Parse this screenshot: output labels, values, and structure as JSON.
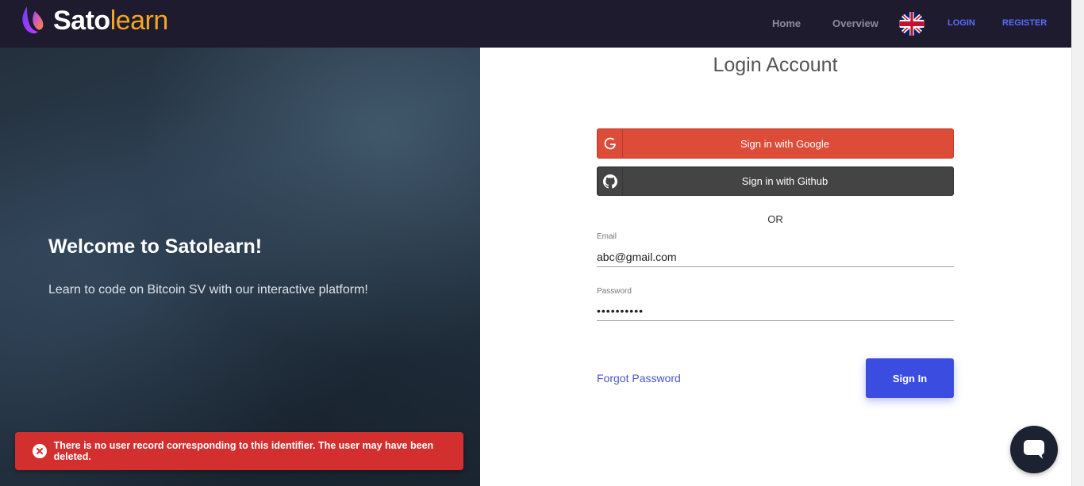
{
  "header": {
    "logo_part1": "Sato",
    "logo_part2": "learn",
    "nav_home": "Home",
    "nav_overview": "Overview",
    "nav_login": "LOGIN",
    "nav_register": "REGISTER",
    "flag_icon": "uk-flag-icon"
  },
  "hero": {
    "title": "Welcome to Satolearn!",
    "subtitle": "Learn to code on Bitcoin SV with our interactive platform!"
  },
  "login": {
    "title": "Login Account",
    "google_label": "Sign in with Google",
    "github_label": "Sign in with Github",
    "or_text": "OR",
    "email_label": "Email",
    "email_value": "abc@gmail.com",
    "password_label": "Password",
    "password_value": "••••••••••",
    "forgot_label": "Forgot Password",
    "signin_label": "Sign In"
  },
  "toast": {
    "message": "There is no user record corresponding to this identifier. The user may have been deleted."
  },
  "colors": {
    "header_bg": "#1d1b2d",
    "brand_orange": "#f5a623",
    "google_red": "#dd4b39",
    "github_gray": "#444444",
    "primary_blue": "#3b4ce0",
    "error_red": "#d32f2f"
  }
}
